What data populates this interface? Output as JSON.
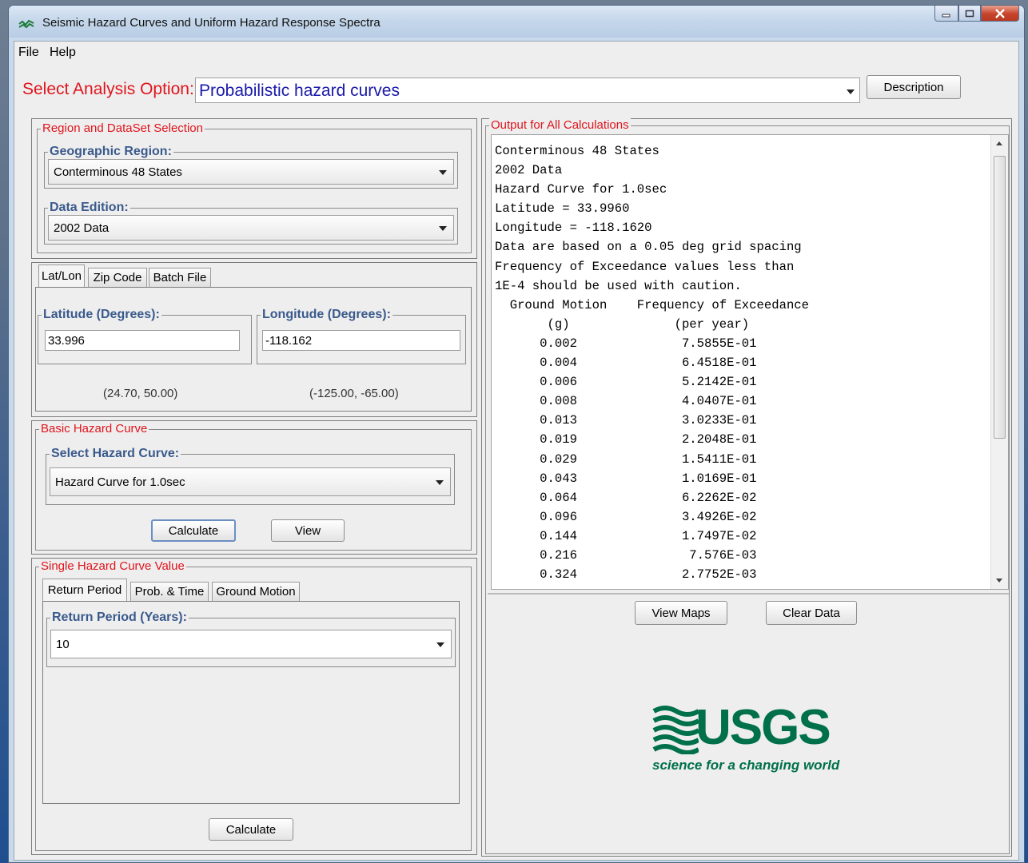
{
  "window": {
    "title": "Seismic Hazard Curves and Uniform Hazard Response Spectra"
  },
  "menu": {
    "file": "File",
    "help": "Help"
  },
  "analysis": {
    "label": "Select Analysis Option:",
    "value": "Probabilistic hazard curves",
    "description_button": "Description"
  },
  "region_panel": {
    "title": "Region and DataSet Selection",
    "geo_label": "Geographic Region:",
    "geo_value": "Conterminous 48 States",
    "edition_label": "Data Edition:",
    "edition_value": "2002 Data"
  },
  "location": {
    "tabs": [
      "Lat/Lon",
      "Zip Code",
      "Batch File"
    ],
    "lat_label": "Latitude (Degrees):",
    "lat_value": "33.996",
    "lat_range": "(24.70, 50.00)",
    "lon_label": "Longitude (Degrees):",
    "lon_value": "-118.162",
    "lon_range": "(-125.00, -65.00)"
  },
  "basic_curve": {
    "title": "Basic Hazard Curve",
    "select_label": "Select Hazard Curve:",
    "select_value": "Hazard Curve for 1.0sec",
    "calculate": "Calculate",
    "view": "View"
  },
  "single_value": {
    "title": "Single Hazard Curve Value",
    "tabs": [
      "Return Period",
      "Prob. & Time",
      "Ground Motion"
    ],
    "rp_label": "Return Period (Years):",
    "rp_value": "10",
    "calculate": "Calculate"
  },
  "output": {
    "title": "Output for All Calculations",
    "text": "Conterminous 48 States\n2002 Data\nHazard Curve for 1.0sec\nLatitude = 33.9960\nLongitude = -118.1620\nData are based on a 0.05 deg grid spacing\nFrequency of Exceedance values less than\n1E-4 should be used with caution.\n  Ground Motion    Frequency of Exceedance\n       (g)              (per year)\n      0.002              7.5855E-01\n      0.004              6.4518E-01\n      0.006              5.2142E-01\n      0.008              4.0407E-01\n      0.013              3.0233E-01\n      0.019              2.2048E-01\n      0.029              1.5411E-01\n      0.043              1.0169E-01\n      0.064              6.2262E-02\n      0.096              3.4926E-02\n      0.144              1.7497E-02\n      0.216               7.576E-03\n      0.324              2.7752E-03",
    "view_maps": "View Maps",
    "clear_data": "Clear Data"
  },
  "logo": {
    "text": "USGS",
    "tagline": "science for a changing world"
  },
  "colors": {
    "label_red": "#e0141c",
    "label_blue": "#3a5a8c",
    "usgs_green": "#00704a"
  }
}
